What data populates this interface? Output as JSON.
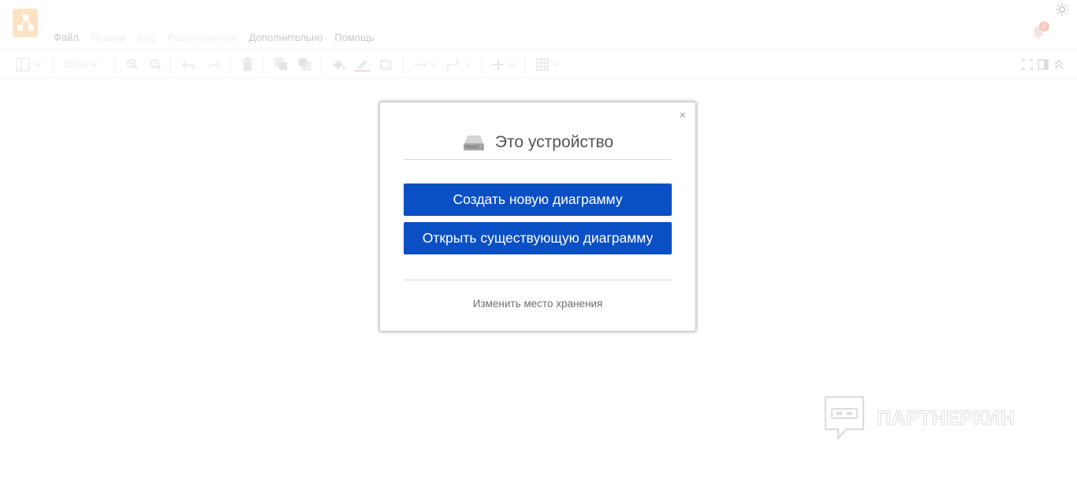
{
  "app": {
    "logo_icon": "drawio-logo-icon",
    "theme_icon": "sun-icon",
    "notification_icon": "bell-icon",
    "notification_count": "0",
    "colors": {
      "logo_bg": "#fde2c4",
      "badge": "#f9c7bc"
    }
  },
  "menu": {
    "items": [
      {
        "label": "Файл"
      },
      {
        "label": "Правка"
      },
      {
        "label": "Вид"
      },
      {
        "label": "Расположение"
      },
      {
        "label": "Дополнительно"
      },
      {
        "label": "Помощь"
      }
    ]
  },
  "toolbar": {
    "zoom_value": "100%",
    "icons": [
      "sidebar-toggle-icon",
      "zoom-in-icon",
      "zoom-out-icon",
      "undo-icon",
      "redo-icon",
      "delete-icon",
      "to-front-icon",
      "to-back-icon",
      "fill-color-icon",
      "line-color-icon",
      "shadow-icon",
      "connection-icon",
      "waypoints-icon",
      "insert-icon",
      "table-icon",
      "fullscreen-icon",
      "format-panel-icon",
      "collapse-icon"
    ]
  },
  "dialog": {
    "close_label": "×",
    "icon": "hard-drive-icon",
    "title": "Это устройство",
    "create_label": "Создать новую диаграмму",
    "open_label": "Открыть существующую диаграмму",
    "change_storage_label": "Изменить место хранения",
    "colors": {
      "button": "#0a50c4",
      "title": "#555555",
      "link": "#6e6e6e"
    }
  },
  "watermark": {
    "icon": "partnerkin-logo-icon",
    "text": "ПАРТНЕРКИН"
  }
}
